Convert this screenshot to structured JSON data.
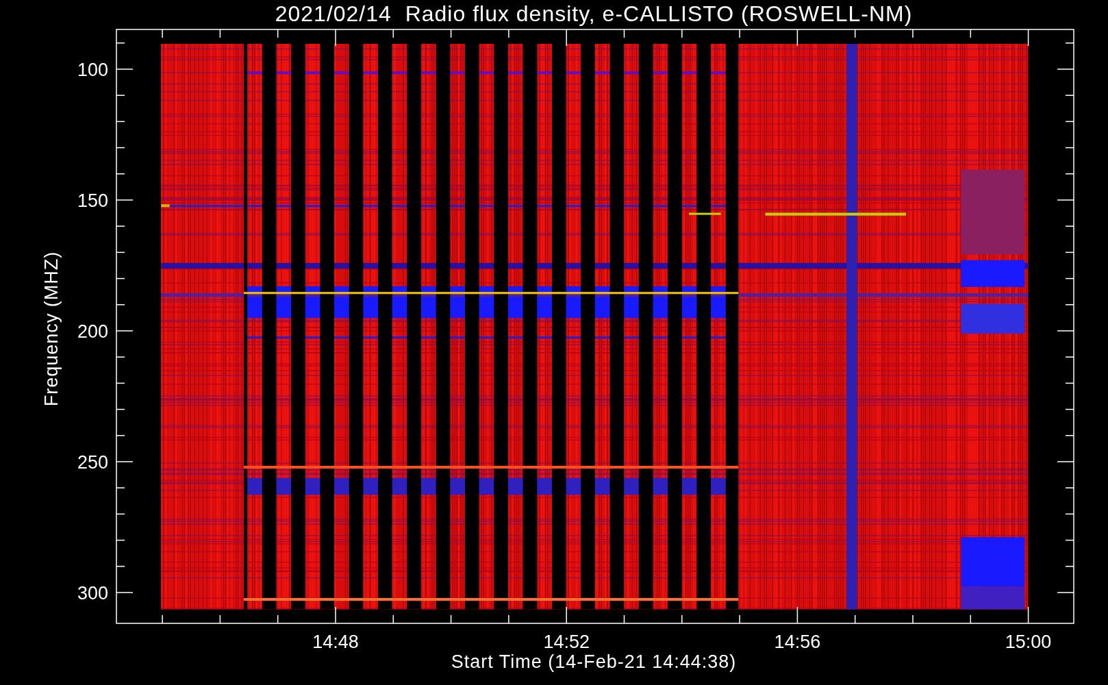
{
  "title": "2021/02/14  Radio flux density, e-CALLISTO (ROSWELL-NM)",
  "y_axis": {
    "label": "Frequency (MHZ)",
    "ticks": [
      "100",
      "150",
      "200",
      "250",
      "300"
    ]
  },
  "x_axis": {
    "label": "Start Time (14-Feb-21 14:44:38)",
    "ticks": [
      "14:48",
      "14:52",
      "14:56",
      "15:00"
    ]
  }
}
